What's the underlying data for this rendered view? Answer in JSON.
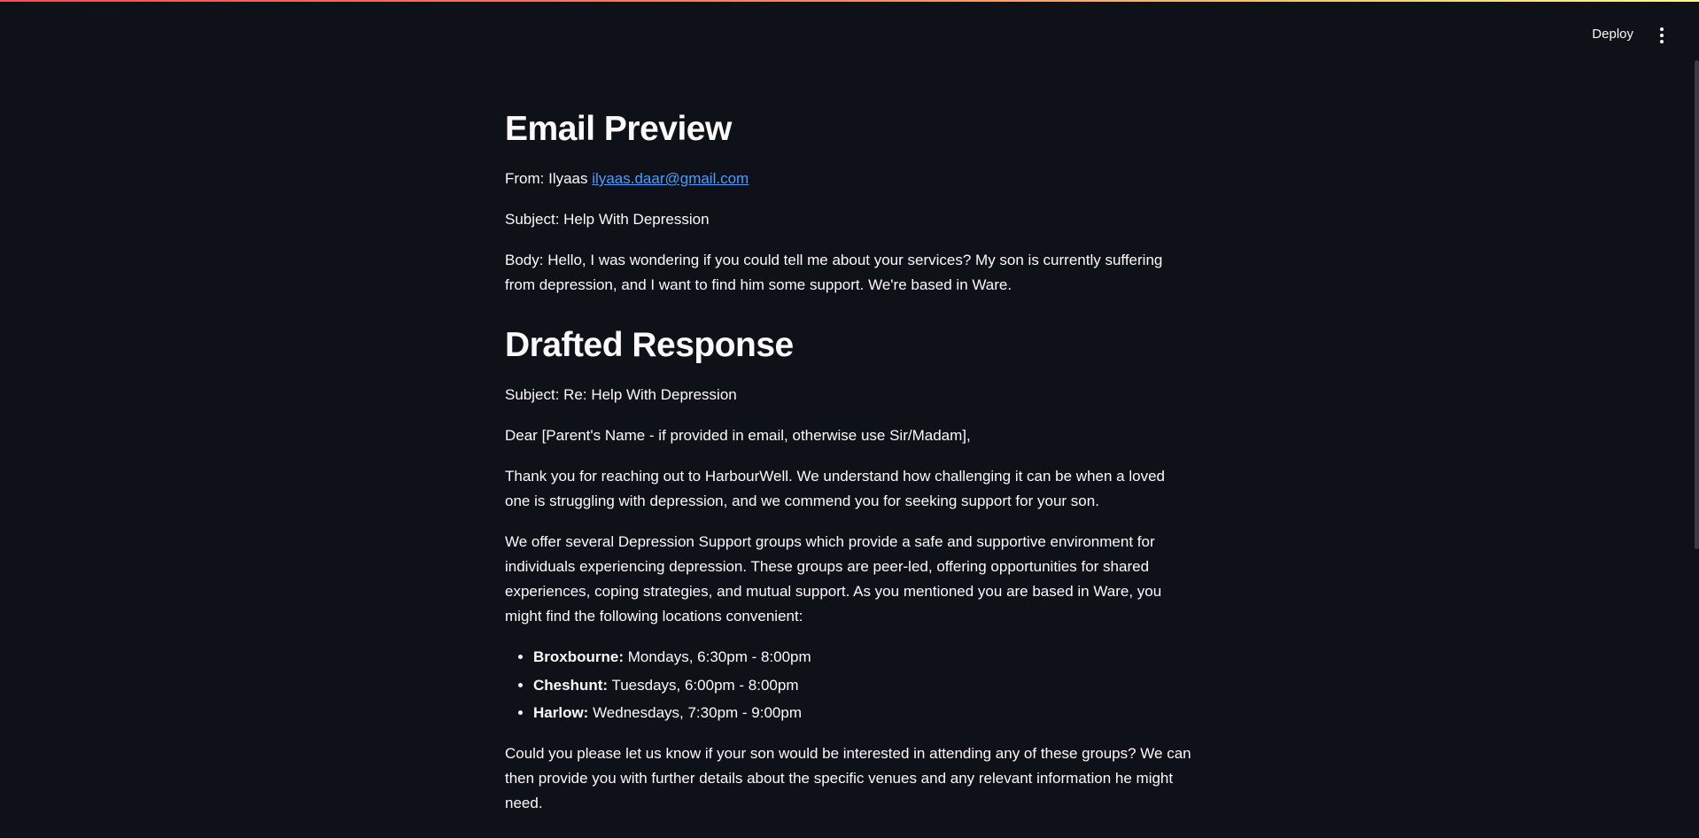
{
  "header": {
    "deploy_label": "Deploy",
    "menu_icon": "more-vertical-icon"
  },
  "email_preview": {
    "title": "Email Preview",
    "from_label": "From: Ilyaas",
    "from_email": "ilyaas.daar@gmail.com",
    "subject": "Subject: Help With Depression",
    "body": "Body: Hello, I was wondering if you could tell me about your services? My son is currently suffering from depression, and I want to find him some support. We're based in Ware."
  },
  "drafted_response": {
    "title": "Drafted Response",
    "subject": "Subject: Re: Help With Depression",
    "greeting": "Dear [Parent's Name - if provided in email, otherwise use Sir/Madam],",
    "para1": "Thank you for reaching out to HarbourWell. We understand how challenging it can be when a loved one is struggling with depression, and we commend you for seeking support for your son.",
    "para2": "We offer several Depression Support groups which provide a safe and supportive environment for individuals experiencing depression. These groups are peer-led, offering opportunities for shared experiences, coping strategies, and mutual support. As you mentioned you are based in Ware, you might find the following locations convenient:",
    "locations": [
      {
        "name": "Broxbourne:",
        "time": " Mondays, 6:30pm - 8:00pm"
      },
      {
        "name": "Cheshunt:",
        "time": " Tuesdays, 6:00pm - 8:00pm"
      },
      {
        "name": "Harlow:",
        "time": " Wednesdays, 7:30pm - 9:00pm"
      }
    ],
    "para3": "Could you please let us know if your son would be interested in attending any of these groups? We can then provide you with further details about the specific venues and any relevant information he might need."
  }
}
